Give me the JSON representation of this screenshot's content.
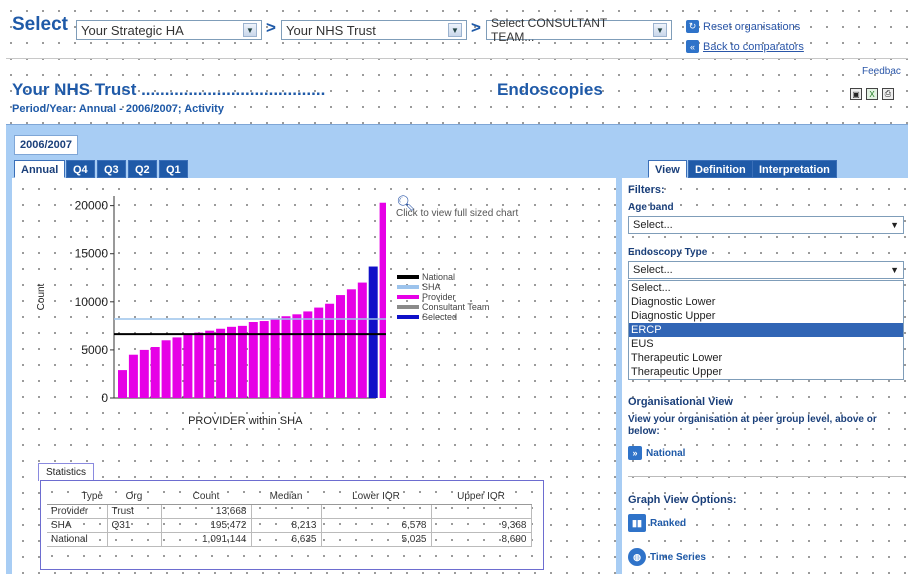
{
  "top": {
    "select_label": "Select",
    "ha_value": "Your Strategic HA",
    "trust_value": "Your NHS Trust",
    "team_value": "Select CONSULTANT TEAM...",
    "arrow_sep": ">",
    "reset_label": "Reset organisations",
    "back_label": "Back to comparators",
    "feedback_label": "Feedbac"
  },
  "header": {
    "trust_title": "Your NHS Trust .......................................",
    "section_title": "Endoscopies",
    "period": "Period/Year: Annual - 2006/2007; Activity"
  },
  "tabs": {
    "year": "2006/2007",
    "periods": [
      "Annual",
      "Q4",
      "Q3",
      "Q2",
      "Q1"
    ],
    "right": [
      "View",
      "Definition",
      "Interpretation"
    ]
  },
  "chart_link": "Click to view full sized chart",
  "chart_data": {
    "type": "bar",
    "xlabel": "PROVIDER within SHA",
    "ylabel": "Count",
    "ylim": [
      0,
      21000
    ],
    "yticks": [
      "0",
      "5000",
      "10000",
      "15000",
      "20000"
    ],
    "ytick_values": [
      0,
      5000,
      10000,
      15000,
      20000
    ],
    "values": [
      2900,
      4500,
      5000,
      5300,
      6000,
      6300,
      6600,
      6800,
      7000,
      7200,
      7400,
      7500,
      7900,
      8000,
      8200,
      8500,
      8700,
      9000,
      9400,
      9800,
      10700,
      11300,
      12000,
      13668,
      20300
    ],
    "selected_index": 23,
    "national_line": 6635,
    "sha_line": 8213,
    "colors": {
      "provider": "#e600e6",
      "selected": "#1010c8",
      "national": "#000000",
      "sha": "#9cc3ec",
      "consultant": "#8a8a8a"
    },
    "legend": [
      "National",
      "SHA",
      "Provider",
      "Consultant Team",
      "Selected"
    ]
  },
  "statistics": {
    "tab_label": "Statistics",
    "headers": [
      "Type",
      "Org",
      "Count",
      "Median",
      "Lower IQR",
      "Upper IQR"
    ],
    "rows": [
      [
        "Provider",
        "Trust",
        "13,668",
        "",
        "",
        ""
      ],
      [
        "SHA",
        "Q31",
        "195,472",
        "8,213",
        "6,578",
        "9,368"
      ],
      [
        "National",
        "",
        "1,091,144",
        "6,635",
        "5,025",
        "8,690"
      ]
    ]
  },
  "filters": {
    "title": "Filters:",
    "age_label": "Age band",
    "age_value": "Select...",
    "endo_label": "Endoscopy Type",
    "endo_value": "Select...",
    "options": [
      "Select...",
      "Diagnostic Lower",
      "Diagnostic Upper",
      "ERCP",
      "EUS",
      "Therapeutic Lower",
      "Therapeutic Upper"
    ],
    "selected_option": "ERCP"
  },
  "org_view": {
    "title": "Organisational View",
    "desc": "View your organisation at peer group level, above or below:",
    "national_link": "National"
  },
  "graph_options": {
    "title": "Graph View Options:",
    "ranked": "Ranked",
    "time_series": "Time Series"
  }
}
